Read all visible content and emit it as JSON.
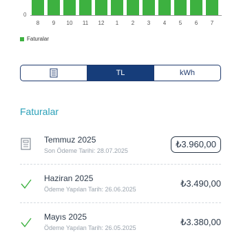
{
  "chart": {
    "y_zero_label": "0",
    "months": [
      "8",
      "9",
      "10",
      "11",
      "12",
      "1",
      "2",
      "3",
      "4",
      "5",
      "6",
      "7"
    ],
    "legend": "Faturalar",
    "bar_color": "#3db140"
  },
  "toggle": {
    "options": [
      {
        "label": "",
        "icon": "document-icon",
        "active": false
      },
      {
        "label": "TL",
        "active": true
      },
      {
        "label": "kWh",
        "active": false
      }
    ]
  },
  "section": {
    "title": "Faturalar"
  },
  "invoices": [
    {
      "month": "Temmuz 2025",
      "sub": "Son Ödeme Tarihi: 28.07.2025",
      "amount": "₺3.960,00",
      "status": "pending",
      "icon": "document-icon"
    },
    {
      "month": "Haziran 2025",
      "sub": "Ödeme Yapılan Tarih: 26.06.2025",
      "amount": "₺3.490,00",
      "status": "paid",
      "icon": "check-icon"
    },
    {
      "month": "Mayıs 2025",
      "sub": "Ödeme Yapılan Tarih: 26.05.2025",
      "amount": "₺3.380,00",
      "status": "paid",
      "icon": "check-icon"
    }
  ]
}
